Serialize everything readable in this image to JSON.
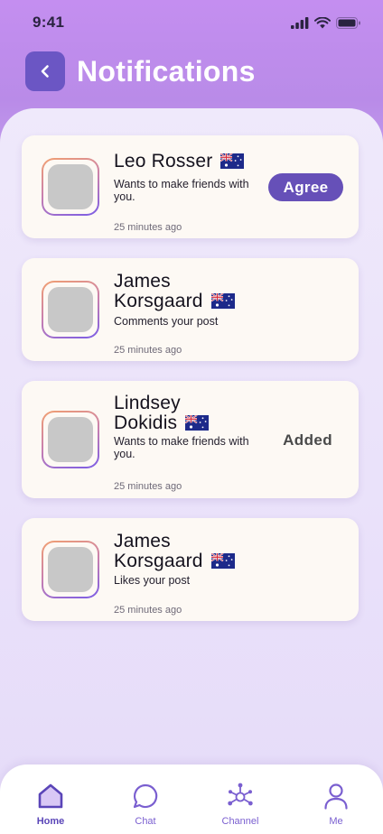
{
  "status_bar": {
    "time": "9:41"
  },
  "header": {
    "title": "Notifications"
  },
  "notifications": [
    {
      "name_lines": [
        "Leo Rosser"
      ],
      "message": "Wants to make friends with you.",
      "time": "25 minutes ago",
      "action": "Agree"
    },
    {
      "name_lines": [
        "James",
        "Korsgaard"
      ],
      "message": "Comments your post",
      "time": "25 minutes ago"
    },
    {
      "name_lines": [
        "Lindsey",
        "Dokidis"
      ],
      "message": "Wants to make friends with you.",
      "time": "25 minutes ago",
      "status": "Added"
    },
    {
      "name_lines": [
        "James",
        "Korsgaard"
      ],
      "message": "Likes your post",
      "time": "25 minutes ago"
    }
  ],
  "tabbar": {
    "items": [
      {
        "label": "Home",
        "icon": "home-icon",
        "active": true
      },
      {
        "label": "Chat",
        "icon": "chat-icon"
      },
      {
        "label": "Channel",
        "icon": "channel-icon"
      },
      {
        "label": "Me",
        "icon": "user-icon"
      }
    ]
  },
  "colors": {
    "accent": "#6650b8",
    "title": "#ffffff",
    "card": "#fdf9f4",
    "tab_active": "#5a45b8"
  }
}
